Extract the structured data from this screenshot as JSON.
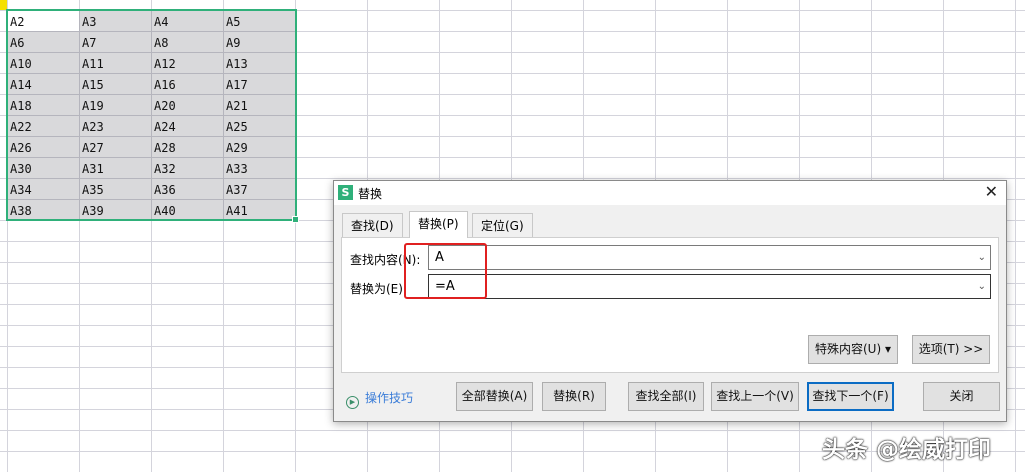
{
  "sheet": {
    "cells": [
      [
        "A2",
        "A3",
        "A4",
        "A5"
      ],
      [
        "A6",
        "A7",
        "A8",
        "A9"
      ],
      [
        "A10",
        "A11",
        "A12",
        "A13"
      ],
      [
        "A14",
        "A15",
        "A16",
        "A17"
      ],
      [
        "A18",
        "A19",
        "A20",
        "A21"
      ],
      [
        "A22",
        "A23",
        "A24",
        "A25"
      ],
      [
        "A26",
        "A27",
        "A28",
        "A29"
      ],
      [
        "A30",
        "A31",
        "A32",
        "A33"
      ],
      [
        "A34",
        "A35",
        "A36",
        "A37"
      ],
      [
        "A38",
        "A39",
        "A40",
        "A41"
      ]
    ]
  },
  "dialog": {
    "logo": "S",
    "title": "替换",
    "close": "✕",
    "tabs": [
      {
        "label": "查找(D)"
      },
      {
        "label": "替换(P)"
      },
      {
        "label": "定位(G)"
      }
    ],
    "find_label": "查找内容(N):",
    "find_value": "A",
    "replace_label": "替换为(E):",
    "replace_value": "=A",
    "special_button": "特殊内容(U) ▾",
    "options_button": "选项(T) >>",
    "tips": "操作技巧",
    "buttons": {
      "replace_all": "全部替换(A)",
      "replace": "替换(R)",
      "find_all": "查找全部(I)",
      "find_prev": "查找上一个(V)",
      "find_next": "查找下一个(F)",
      "close": "关闭"
    }
  },
  "watermark": "头条 @绘威打印"
}
